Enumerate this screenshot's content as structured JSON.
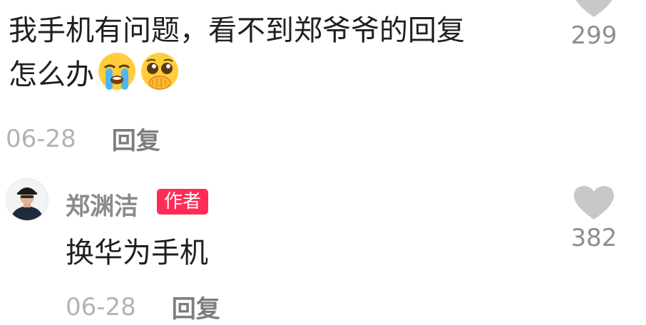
{
  "comment": {
    "text_line1": "我手机有问题，看不到郑爷爷的回复",
    "text_line2": "怎么办",
    "emojis": [
      "crying-face-emoji",
      "pleading-face-hands-over-mouth-emoji"
    ],
    "date": "06-28",
    "reply_label": "回复",
    "like_count": "299"
  },
  "reply": {
    "author_name": "郑渊洁",
    "author_badge": "作者",
    "text": "换华为手机",
    "date": "06-28",
    "reply_label": "回复",
    "like_count": "382"
  },
  "colors": {
    "badge": "#ff2c55",
    "heart": "#c8c8c8",
    "text": "#1f1f1f"
  }
}
